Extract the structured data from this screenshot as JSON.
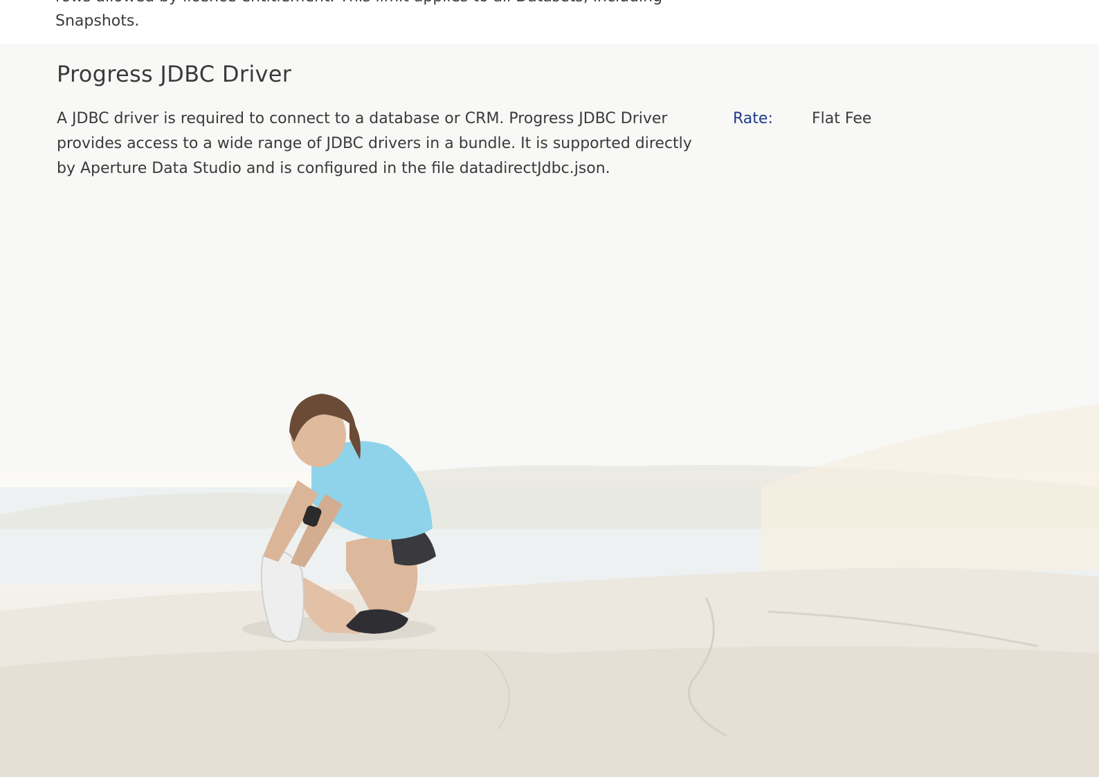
{
  "intro": {
    "text": "rows allowed by licence entitlement. This limit applies to all Datasets, including Snapshots."
  },
  "section": {
    "title": "Progress JDBC Driver",
    "description": "A JDBC driver is required to connect to a database or CRM. Progress JDBC Driver provides access to a wide range of JDBC drivers in a bundle. It is supported directly by Aperture Data Studio and is configured in the file datadirectJdbc.json.",
    "rate_label": "Rate:",
    "rate_value": "Flat Fee"
  },
  "colors": {
    "rate_label": "#1e3a8a",
    "body_text": "#3a3a3a",
    "background": "#ffffff"
  }
}
